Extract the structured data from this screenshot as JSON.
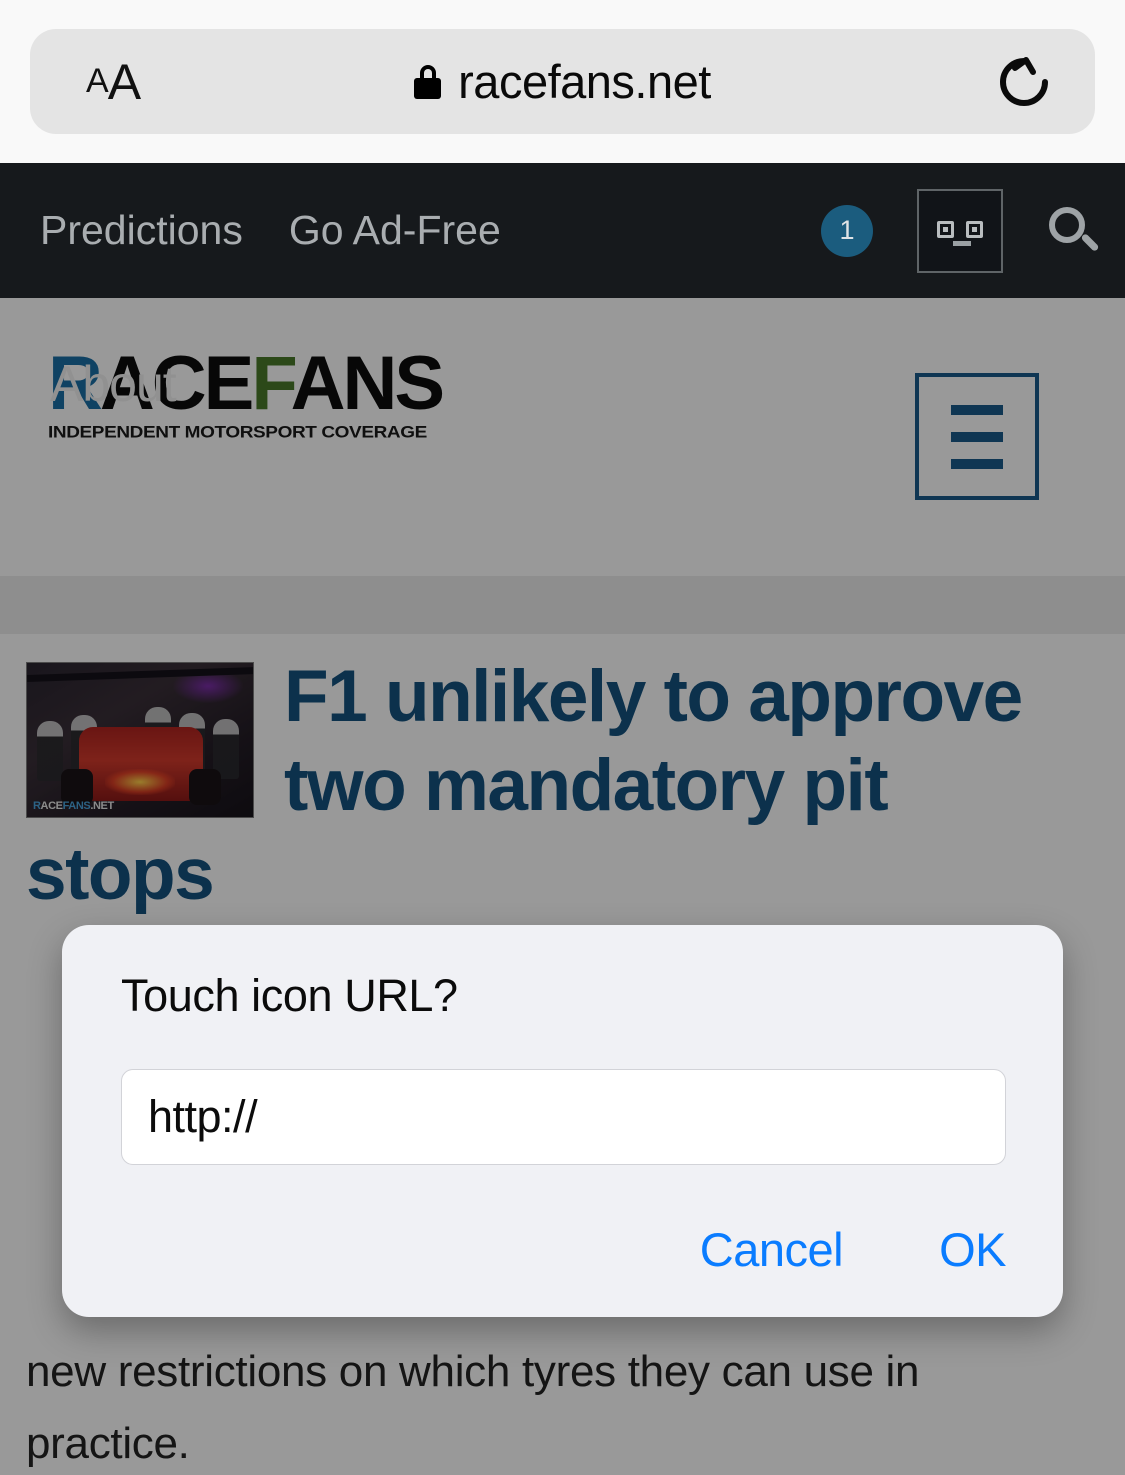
{
  "browser": {
    "text_size_small": "A",
    "text_size_large": "A",
    "lock_icon": "lock-icon",
    "url": "racefans.net",
    "reload_icon": "reload-icon"
  },
  "site_topnav": {
    "links": [
      {
        "label": "Predictions"
      },
      {
        "label": "Go Ad-Free"
      }
    ],
    "notification_count": "1",
    "avatar_icon": "avatar-face-icon",
    "search_icon": "search-icon",
    "background_color": "#16191c",
    "link_color": "#a9adb0",
    "badge_color": "#1b5c7e"
  },
  "site_header": {
    "logo": {
      "part_r": "R",
      "part_ace": "ACE",
      "part_f": "F",
      "part_ans": "ANS",
      "tagline": "INDEPENDENT MOTORSPORT COVERAGE",
      "color_r": "#1a6ea5",
      "color_f": "#4a7b2a",
      "color_dark": "#0d0d0d"
    },
    "ghost_text": "About",
    "menu_icon": "hamburger-menu-icon",
    "menu_color": "#1a5b8a"
  },
  "article": {
    "thumbnail_watermark_prefix": "R",
    "thumbnail_watermark_mid": "ACE",
    "thumbnail_watermark_suffix": "FANS",
    "thumbnail_watermark_tld": ".NET",
    "headline": "F1 unlikely to approve two mandatory pit stops",
    "headline_color": "#15537f",
    "body_text": "new restrictions on which tyres they can use in practice."
  },
  "dialog": {
    "title": "Touch icon URL?",
    "input_value": "http://",
    "input_placeholder": "http://",
    "cancel_label": "Cancel",
    "ok_label": "OK",
    "button_color": "#0a7cff",
    "background_color": "#f0f1f5"
  }
}
